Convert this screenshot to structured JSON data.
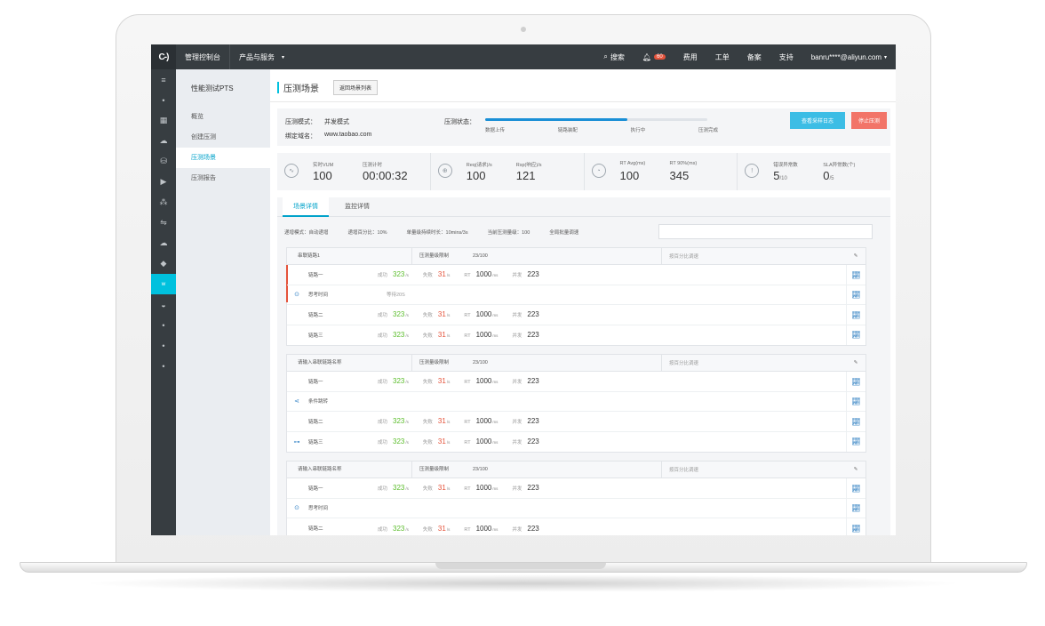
{
  "topbar": {
    "logo": "C-)",
    "console": "管理控制台",
    "products": "产品与服务",
    "search": "搜索",
    "notif_count": "60",
    "billing": "费用",
    "tickets": "工单",
    "icp": "备案",
    "support": "支持",
    "user": "banru****@aliyun.com"
  },
  "sidenav": {
    "title": "性能测试PTS",
    "items": [
      "概览",
      "创建压测",
      "压测场景",
      "压测报告"
    ]
  },
  "page": {
    "title": "压测场景",
    "list_button": "返回场景列表",
    "mode_label": "压测模式：",
    "mode_value": "并发模式",
    "domain_label": "绑定域名：",
    "domain_value": "www.taobao.com",
    "status_label": "压测状态：",
    "progress": 0.64,
    "steps": [
      "数据上传",
      "链路装配",
      "执行中",
      "压测完成"
    ],
    "btn_sample": "查看采样日志",
    "btn_stop": "停止压测"
  },
  "metrics": [
    {
      "icon": "∿",
      "l1": "实时VUM",
      "v1": "100",
      "l2": "压测计时",
      "v2": "00:00:32",
      "u2": ""
    },
    {
      "icon": "⊕",
      "l1": "Req(请求)/s",
      "v1": "100",
      "l2": "Rsp(响应)/s",
      "v2": "121",
      "u2": ""
    },
    {
      "icon": "◔",
      "l1": "RT Avg(ms)",
      "v1": "100",
      "l2": "RT 90%(ms)",
      "v2": "345",
      "u2": ""
    },
    {
      "icon": "!",
      "l1": "错误异常数",
      "v1": "5",
      "u1": "/10",
      "l2": "SLA异常数(个)",
      "v2": "0",
      "u2": "/5"
    }
  ],
  "tabs": [
    "场景详情",
    "监控详情"
  ],
  "filter": {
    "mode": "递增模式：自动递增",
    "percent": "递增百分比：10%",
    "duration": "单量级持续时长：10mins/3s",
    "current": "当前压测量级：100",
    "global": "全局批量调速"
  },
  "groups": [
    {
      "name": "串联链路1",
      "limit_label": "压测量级限制",
      "limit_value": "23/100",
      "adjust": "按百分比调速",
      "rows": [
        {
          "type": "link",
          "name": "链路一",
          "ok": "323",
          "fail": "31",
          "rt": "1000",
          "conc": "223"
        },
        {
          "type": "think",
          "name": "思考时间",
          "wait": "等待20S"
        },
        {
          "type": "link",
          "name": "链路二",
          "ok": "323",
          "fail": "31",
          "rt": "1000",
          "conc": "223"
        },
        {
          "type": "link",
          "name": "链路三",
          "ok": "323",
          "fail": "31",
          "rt": "1000",
          "conc": "223"
        }
      ]
    },
    {
      "name": "请输入串联链路名称",
      "limit_label": "压测量级限制",
      "limit_value": "23/100",
      "adjust": "按百分比调速",
      "rows": [
        {
          "type": "link",
          "name": "链路一",
          "ok": "323",
          "fail": "31",
          "rt": "1000",
          "conc": "223"
        },
        {
          "type": "branch",
          "name": "条件跳转"
        },
        {
          "type": "link",
          "name": "链路二",
          "ok": "323",
          "fail": "31",
          "rt": "1000",
          "conc": "223"
        },
        {
          "type": "linked",
          "name": "链路三",
          "ok": "323",
          "fail": "31",
          "rt": "1000",
          "conc": "223"
        }
      ]
    },
    {
      "name": "请输入串联链路名称",
      "limit_label": "压测量级限制",
      "limit_value": "23/100",
      "adjust": "按百分比调速",
      "rows": [
        {
          "type": "link",
          "name": "链路一",
          "ok": "323",
          "fail": "31",
          "rt": "1000",
          "conc": "223"
        },
        {
          "type": "think",
          "name": "思考时间"
        },
        {
          "type": "link",
          "name": "链路二",
          "ok": "323",
          "fail": "31",
          "rt": "1000",
          "conc": "223"
        }
      ]
    }
  ],
  "labels": {
    "ok": "成功",
    "fail": "失败",
    "rt": "RT",
    "conc": "并发",
    "per_sec": "/s",
    "ms": "ms"
  }
}
